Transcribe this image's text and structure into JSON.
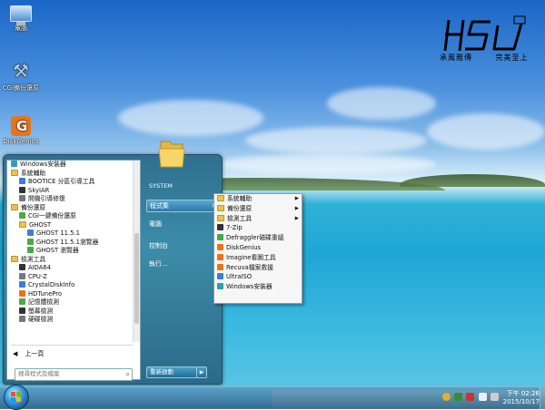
{
  "desktop": {
    "icons": [
      {
        "label": "電腦",
        "icon": "computer-icon"
      },
      {
        "label": "CGI備份還原",
        "icon": "tools-icon"
      },
      {
        "label": "DiskGenius",
        "icon": "diskgenius-icon"
      }
    ],
    "logo": {
      "mark": "HSU",
      "left_text": "承風雅傳",
      "right_text": "完美至上"
    }
  },
  "start_menu": {
    "programs": [
      {
        "label": "Windows安裝器",
        "icon": "windows-installer-icon",
        "indent": 0
      },
      {
        "label": "系統輔助",
        "icon": "folder-icon",
        "indent": 0
      },
      {
        "label": "BOOTICE 分區引導工具",
        "icon": "bootice-icon",
        "indent": 1
      },
      {
        "label": "SkyIAR",
        "icon": "skyiar-icon",
        "indent": 1
      },
      {
        "label": "開機引導修復",
        "icon": "boot-repair-icon",
        "indent": 1
      },
      {
        "label": "備份還原",
        "icon": "folder-icon",
        "indent": 0
      },
      {
        "label": "CGI一鍵備份還原",
        "icon": "cgi-icon",
        "indent": 1
      },
      {
        "label": "GHOST",
        "icon": "folder-icon",
        "indent": 1
      },
      {
        "label": "GHOST 11.5.1",
        "icon": "ghost-icon",
        "indent": 2
      },
      {
        "label": "GHOST 11.5.1瀏覽器",
        "icon": "ghost-explorer-icon",
        "indent": 2
      },
      {
        "label": "GHOST 瀏覽器",
        "icon": "ghost-explorer-icon",
        "indent": 2
      },
      {
        "label": "檢測工具",
        "icon": "folder-icon",
        "indent": 0
      },
      {
        "label": "AIDA64",
        "icon": "aida64-icon",
        "indent": 1
      },
      {
        "label": "CPU-Z",
        "icon": "cpuz-icon",
        "indent": 1
      },
      {
        "label": "CrystalDiskInfo",
        "icon": "crystaldiskinfo-icon",
        "indent": 1
      },
      {
        "label": "HDTunePro",
        "icon": "hdtune-icon",
        "indent": 1
      },
      {
        "label": "記憶體檢測",
        "icon": "memtest-icon",
        "indent": 1
      },
      {
        "label": "螢幕檢測",
        "icon": "monitor-test-icon",
        "indent": 1
      },
      {
        "label": "硬碟檢測",
        "icon": "disk-test-icon",
        "indent": 1
      }
    ],
    "back_label": "上一頁",
    "search_placeholder": "搜尋程式及檔案",
    "user_name": "SYSTEM",
    "right_items": [
      {
        "label": "程式集",
        "selected": true,
        "has_arrow": true
      },
      {
        "label": "電腦",
        "selected": false,
        "has_arrow": false
      },
      {
        "label": "控制台",
        "selected": false,
        "has_arrow": false
      },
      {
        "label": "執行...",
        "selected": false,
        "has_arrow": false
      }
    ],
    "shutdown_label": "重新啟動"
  },
  "submenu": {
    "items": [
      {
        "label": "系統輔助",
        "icon": "folder-icon",
        "has_arrow": true
      },
      {
        "label": "備份還原",
        "icon": "folder-icon",
        "has_arrow": true
      },
      {
        "label": "檢測工具",
        "icon": "folder-icon",
        "has_arrow": true
      },
      {
        "label": "7-Zip",
        "icon": "7zip-icon",
        "has_arrow": false
      },
      {
        "label": "Defraggler磁碟重組",
        "icon": "defraggler-icon",
        "has_arrow": false
      },
      {
        "label": "DiskGenius",
        "icon": "diskgenius-icon",
        "has_arrow": false
      },
      {
        "label": "Imagine看圖工具",
        "icon": "imagine-icon",
        "has_arrow": false
      },
      {
        "label": "Recuva檔案救援",
        "icon": "recuva-icon",
        "has_arrow": false
      },
      {
        "label": "UltraISO",
        "icon": "ultraiso-icon",
        "has_arrow": false
      },
      {
        "label": "Windows安裝器",
        "icon": "windows-installer-icon",
        "has_arrow": false
      }
    ]
  },
  "taskbar": {
    "clock_time": "下午 02:26",
    "clock_date": "2015/10/17"
  }
}
